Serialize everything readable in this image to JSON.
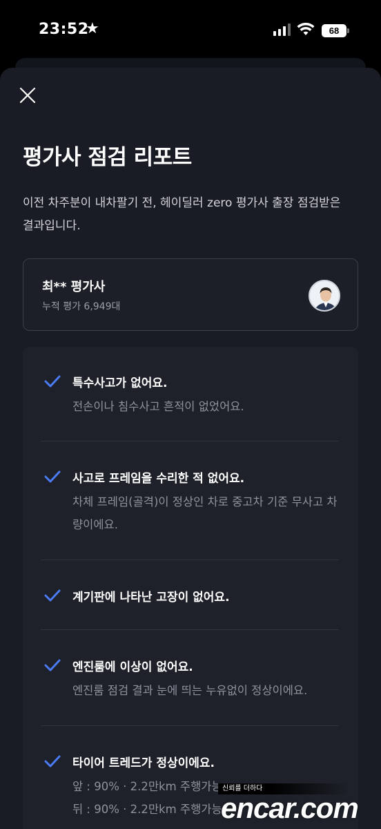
{
  "status_bar": {
    "time": "23:52",
    "battery": "68"
  },
  "header": {
    "title": "평가사 점검 리포트"
  },
  "description": "이전 차주분이 내차팔기 전, 헤이딜러 zero 평가사 출장 점검받은 결과입니다.",
  "appraiser": {
    "name": "최** 평가사",
    "count": "누적 평가 6,949대"
  },
  "checklist": [
    {
      "title": "특수사고가 없어요.",
      "subtitle": "전손이나 침수사고 흔적이 없었어요."
    },
    {
      "title": "사고로 프레임을 수리한 적 없어요.",
      "subtitle": "차체 프레임(골격)이 정상인 차로 중고차 기준 무사고 차량이에요."
    },
    {
      "title": "계기판에 나타난 고장이 없어요.",
      "subtitle": ""
    },
    {
      "title": "엔진룸에 이상이 없어요.",
      "subtitle": "엔진룸 점검 결과 눈에 띄는 누유없이 정상이에요."
    },
    {
      "title": "타이어 트레드가 정상이에요.",
      "front": "앞 : 90% · 2.2만km 주행가능",
      "rear": "뒤 : 90% · 2.2만km 주행가능"
    }
  ],
  "watermark": {
    "tag": "신뢰를 더하다",
    "logo": "encar.com"
  },
  "colors": {
    "accent": "#4a7cf6",
    "sheet": "#191c24",
    "card": "#1e2129"
  }
}
